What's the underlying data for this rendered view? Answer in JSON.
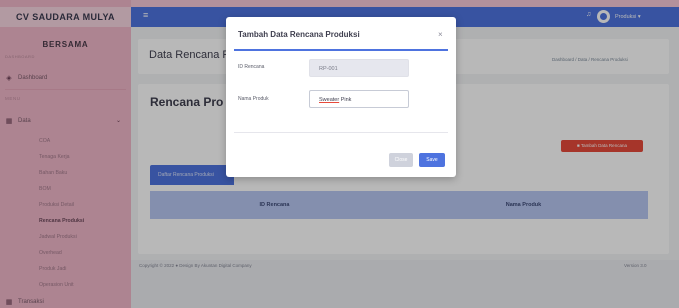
{
  "sidebar": {
    "brand": "CV SAUDARA MULYA",
    "org": "BERSAMA",
    "org_sub": "DASHBOARD",
    "dashboard": "Dashboard",
    "interface_heading": "MENU",
    "data": "Data",
    "items": [
      "COA",
      "Tenaga Kerja",
      "Bahan Baku",
      "BOM",
      "Produksi Detail",
      "Rencana Produksi",
      "Jadwal Produksi",
      "Overhead",
      "Produk Jadi",
      "Operasion Unit"
    ],
    "transaksi": "Transaksi"
  },
  "topbar": {
    "user_name": "Produksi ▾"
  },
  "page": {
    "title": "Data Rencana P",
    "breadcrumb": "Dashboard / Data / Rencana Produksi",
    "card_title": "Rencana Pro",
    "add_button": "Tambah Data Rencana",
    "tab_label": "Daftar Rencana Produksi",
    "columns": [
      "ID Rencana",
      "Nama Produk"
    ]
  },
  "footer": {
    "copyright": "Copyright © 2022 ● Design By Akuntan Digital Company",
    "version": "Version 3.0"
  },
  "modal": {
    "title": "Tambah Data Rencana Produksi",
    "close_symbol": "×",
    "id_label": "ID Rencana",
    "id_value": "RP-001",
    "product_label": "Nama Produk",
    "product_value_first": "Sweater",
    "product_value_rest": " Pink",
    "close_button": "Close",
    "save_button": "Save"
  }
}
